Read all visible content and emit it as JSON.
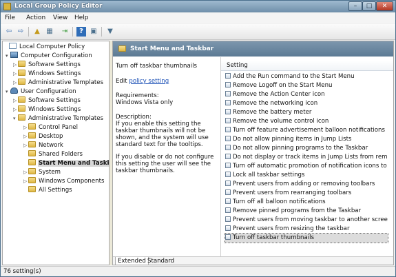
{
  "window": {
    "title": "Local Group Policy Editor",
    "min": "–",
    "max": "□",
    "close": "✕"
  },
  "menu": [
    "File",
    "Action",
    "View",
    "Help"
  ],
  "toolbar": {
    "back": "⇦",
    "forward": "⇨",
    "up": "▲",
    "props": "▦",
    "export": "⇥",
    "help": "?",
    "showhide": "▣",
    "filter": "▼"
  },
  "tree": [
    {
      "label": "Local Computer Policy",
      "icon": "doc",
      "twisty": ""
    },
    {
      "label": "Computer Configuration",
      "icon": "comp",
      "twisty": "▾"
    },
    {
      "label": "Software Settings",
      "icon": "fld",
      "twisty": "▷"
    },
    {
      "label": "Windows Settings",
      "icon": "fld",
      "twisty": "▷"
    },
    {
      "label": "Administrative Templates",
      "icon": "fld",
      "twisty": "▷"
    },
    {
      "label": "User Configuration",
      "icon": "usr",
      "twisty": "▾"
    },
    {
      "label": "Software Settings",
      "icon": "fld",
      "twisty": "▷"
    },
    {
      "label": "Windows Settings",
      "icon": "fld",
      "twisty": "▷"
    },
    {
      "label": "Administrative Templates",
      "icon": "fld",
      "twisty": "▾"
    },
    {
      "label": "Control Panel",
      "icon": "fld",
      "twisty": "▷"
    },
    {
      "label": "Desktop",
      "icon": "fld",
      "twisty": "▷"
    },
    {
      "label": "Network",
      "icon": "fld",
      "twisty": "▷"
    },
    {
      "label": "Shared Folders",
      "icon": "fld",
      "twisty": ""
    },
    {
      "label": "Start Menu and Taskbar",
      "icon": "fld",
      "twisty": "",
      "selected": true
    },
    {
      "label": "System",
      "icon": "fld",
      "twisty": "▷"
    },
    {
      "label": "Windows Components",
      "icon": "fld",
      "twisty": "▷"
    },
    {
      "label": "All Settings",
      "icon": "fld",
      "twisty": ""
    }
  ],
  "right_header": "Start Menu and Taskbar",
  "extended": {
    "heading": "Turn off taskbar thumbnails",
    "edit_prefix": "Edit ",
    "edit_link": "policy setting",
    "requirements_label": "Requirements:",
    "requirements": "Windows Vista only",
    "description_label": "Description:",
    "description": "If you enable this setting the taskbar thumbnails will not be shown, and the system will use standard text for the tooltips.",
    "description2": "If you disable or do not configure this setting the user will see the taskbar thumbnails."
  },
  "list": {
    "column": "Setting",
    "rows": [
      "Add the Run command to the Start Menu",
      "Remove Logoff on the Start Menu",
      "Remove the Action Center icon",
      "Remove the networking icon",
      "Remove the battery meter",
      "Remove the volume control icon",
      "Turn off feature advertisement balloon notifications",
      "Do not allow pinning items in Jump Lists",
      "Do not allow pinning programs to the Taskbar",
      "Do not display or track items in Jump Lists from remote locations",
      "Turn off automatic promotion of notification icons to the taskbar",
      "Lock all taskbar settings",
      "Prevent users from adding or removing toolbars",
      "Prevent users from rearranging toolbars",
      "Turn off all balloon notifications",
      "Remove pinned programs from the Taskbar",
      "Prevent users from moving taskbar to another screen dock location",
      "Prevent users from resizing the taskbar",
      "Turn off taskbar thumbnails"
    ],
    "selected_index": 18
  },
  "tabs": [
    "Extended",
    "Standard"
  ],
  "status": "76 setting(s)"
}
